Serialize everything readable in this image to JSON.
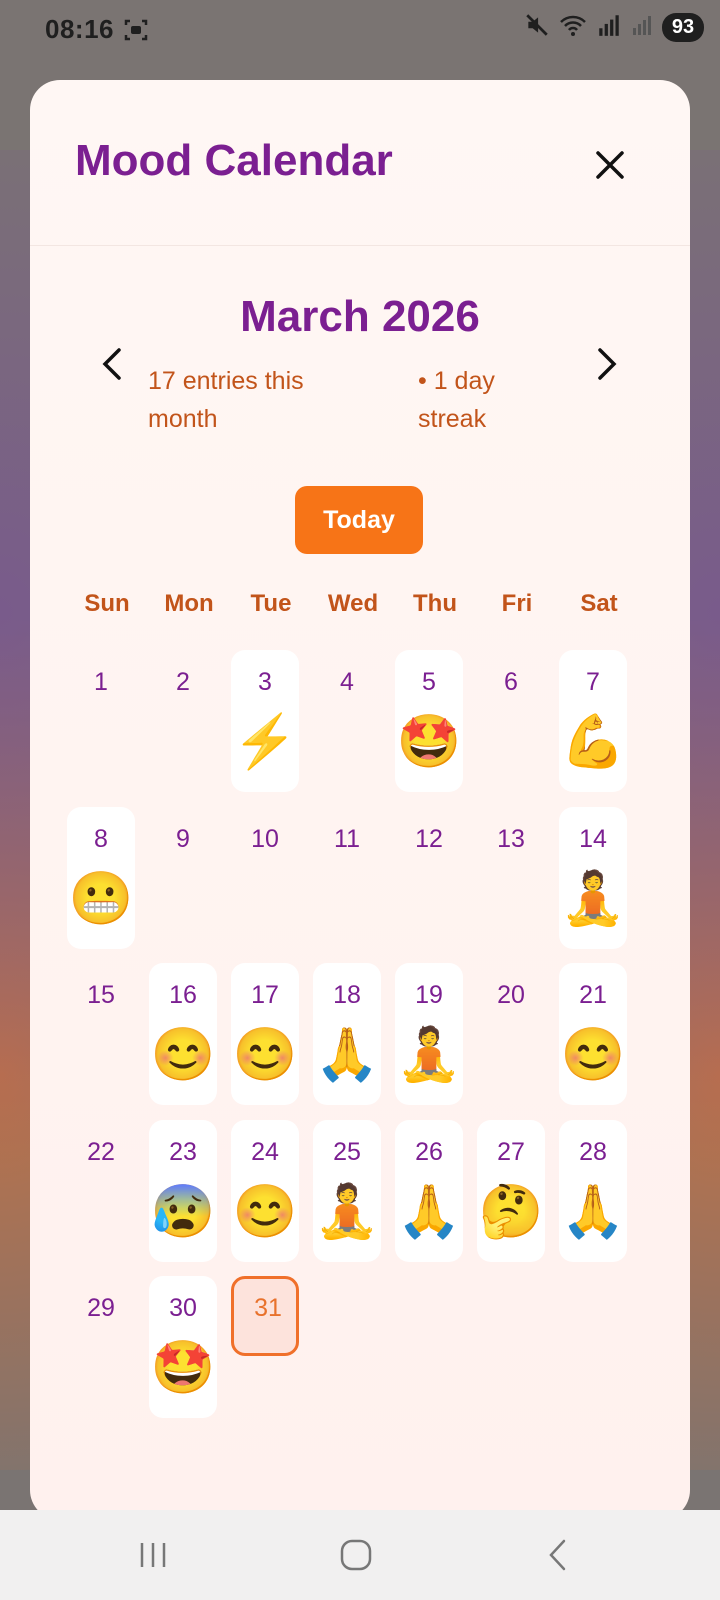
{
  "status_bar": {
    "time": "08:16",
    "battery": "93",
    "icons": [
      "screenshot-icon",
      "mute-icon",
      "wifi-icon",
      "signal-r-icon",
      "signal-icon"
    ]
  },
  "dialog": {
    "title": "Mood Calendar",
    "close_icon": "close-icon"
  },
  "calendar": {
    "month_label": "March 2026",
    "entries_text": "17 entries this month",
    "streak_text": "• 1 day streak",
    "today_label": "Today",
    "weekdays": [
      "Sun",
      "Mon",
      "Tue",
      "Wed",
      "Thu",
      "Fri",
      "Sat"
    ],
    "start_weekday": 0,
    "days_in_month": 31,
    "today": 31,
    "entries": {
      "3": "⚡",
      "5": "🤩",
      "7": "💪",
      "8": "😬",
      "14": "🧘",
      "16": "😊",
      "17": "😊",
      "18": "🙏",
      "19": "🧘",
      "21": "😊",
      "23": "😰",
      "24": "😊",
      "25": "🧘",
      "26": "🙏",
      "27": "🤔",
      "28": "🙏",
      "30": "🤩"
    }
  },
  "colors": {
    "accent_purple": "#7b1f91",
    "accent_orange": "#f77417",
    "text_orange": "#c2541a"
  },
  "nav_bar": {
    "icons": [
      "recents-icon",
      "home-icon",
      "back-icon"
    ]
  }
}
